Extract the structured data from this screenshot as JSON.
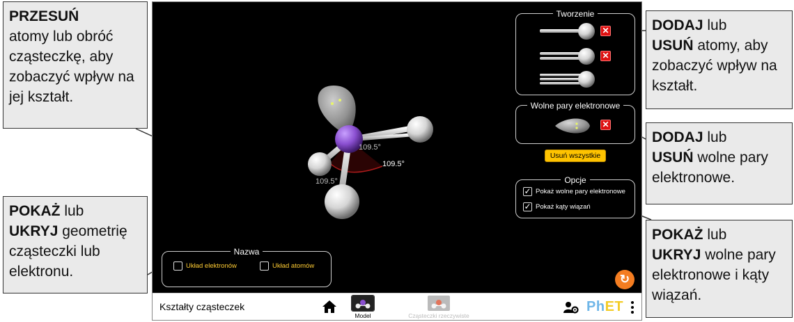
{
  "callouts": {
    "move": {
      "bold": "PRZESUŃ",
      "text": "atomy lub obróć cząsteczkę, aby zobaczyć wpływ na jej kształt."
    },
    "show_geometry": {
      "bold1": "POKAŻ",
      "mid1": " lub",
      "bold2": "UKRYJ",
      "text": " geometrię cząsteczki lub elektronu."
    },
    "add_atoms": {
      "bold1": "DODAJ",
      "mid1": " lub",
      "bold2": "USUŃ",
      "text": " atomy, aby zobaczyć wpływ na kształt."
    },
    "add_lone_pairs": {
      "bold1": "DODAJ",
      "mid1": " lub",
      "bold2": "USUŃ",
      "text": " wolne pary elektronowe."
    },
    "show_lone_pairs": {
      "bold1": "POKAŻ",
      "mid1": " lub",
      "bold2": "UKRYJ",
      "text": " wolne pary elektronowe i kąty wiązań."
    }
  },
  "molecule": {
    "angle_labels": [
      "109.5°",
      "109.5°",
      "109.5°"
    ]
  },
  "panels": {
    "tworzenie": {
      "title": "Tworzenie"
    },
    "wolne_pary": {
      "title": "Wolne pary elektronowe"
    },
    "remove_all_label": "Usuń wszystkie",
    "opcje": {
      "title": "Opcje",
      "options": [
        {
          "label": "Pokaż wolne pary elektronowe",
          "checked": true
        },
        {
          "label": "Pokaż kąty wiązań",
          "checked": true
        }
      ]
    },
    "nazwa": {
      "title": "Nazwa",
      "options": [
        {
          "label": "Układ elektronów",
          "checked": false
        },
        {
          "label": "Układ atomów",
          "checked": false
        }
      ]
    }
  },
  "navbar": {
    "title": "Kształty cząsteczek",
    "tabs": [
      {
        "label": "Model",
        "selected": true
      },
      {
        "label": "Cząsteczki rzeczywiste",
        "selected": false
      }
    ],
    "logo": "PhET"
  },
  "icons": {
    "home": "home-icon",
    "user_settings": "user-gear-icon",
    "menu": "kebab-menu-icon",
    "reset": "reset-icon",
    "remove": "close-icon",
    "check": "checkmark-icon"
  },
  "colors": {
    "central_atom": "#8a4fd0",
    "remove_button": "#dd1111",
    "remove_all_button": "#fec300",
    "reset_button": "#f47d21",
    "bond_angle_arc": "#cc2222"
  }
}
